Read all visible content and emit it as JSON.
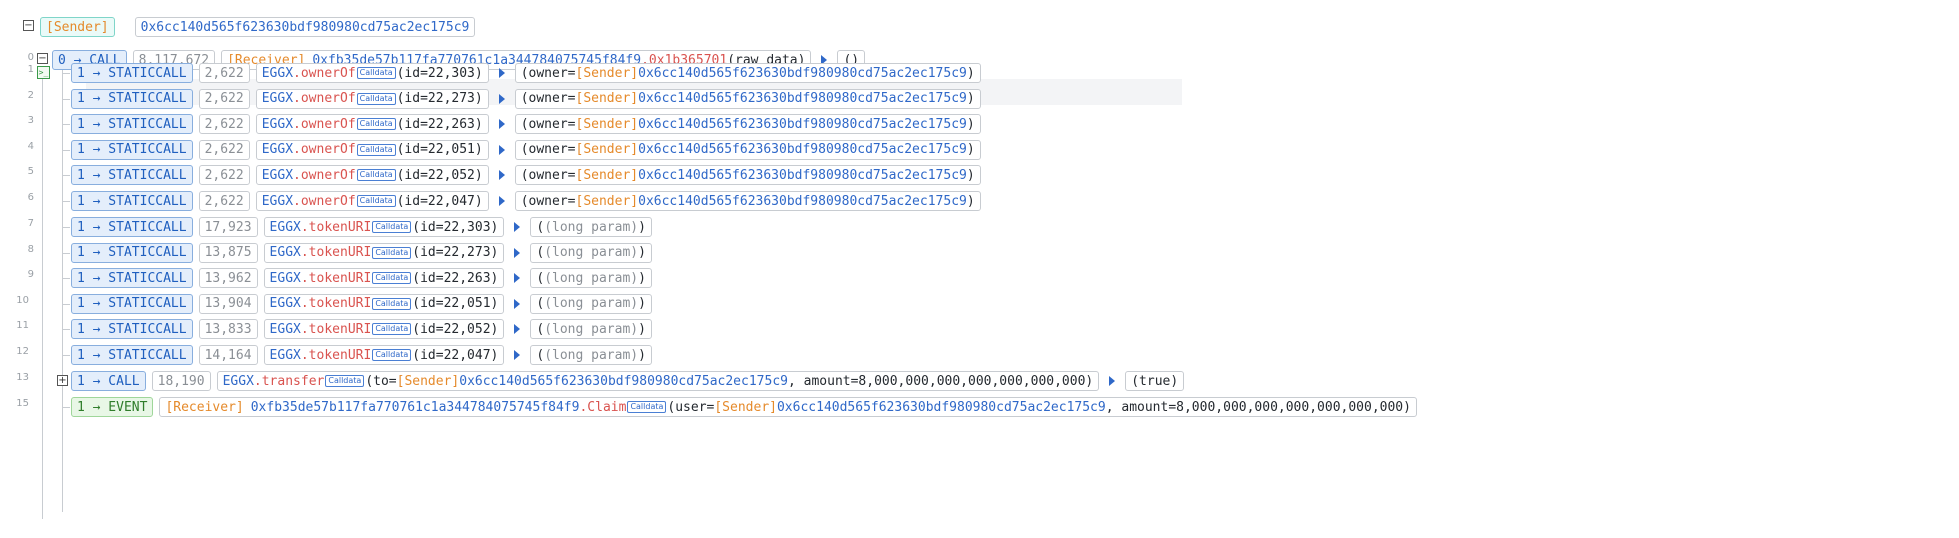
{
  "root": {
    "sender_label": "[Sender]",
    "sender_address": "0x6cc140d565f623630bdf980980cd75ac2ec175c9"
  },
  "main_call": {
    "line": "0",
    "call_label": "0 → CALL",
    "gas": "8,117,672",
    "receiver_label": "[Receiver]",
    "receiver_address": "0xfb35de57b117fa770761c1a344784075745f84f9",
    "selector": ".0x1b365701",
    "raw": "(raw data)",
    "result": "()"
  },
  "calldata_badge": "Calldata",
  "owner_calls": [
    {
      "line": "1",
      "call_label": "1 → STATICCALL",
      "gas": "2,622",
      "contract": "EGGX",
      "method": ".ownerOf",
      "args": "(id=22,303)",
      "ret_open": "(owner=",
      "ret_tag": "[Sender]",
      "ret_addr": "0x6cc140d565f623630bdf980980cd75ac2ec175c9",
      "ret_close": ")"
    },
    {
      "line": "2",
      "call_label": "1 → STATICCALL",
      "gas": "2,622",
      "contract": "EGGX",
      "method": ".ownerOf",
      "args": "(id=22,273)",
      "ret_open": "(owner=",
      "ret_tag": "[Sender]",
      "ret_addr": "0x6cc140d565f623630bdf980980cd75ac2ec175c9",
      "ret_close": ")"
    },
    {
      "line": "3",
      "call_label": "1 → STATICCALL",
      "gas": "2,622",
      "contract": "EGGX",
      "method": ".ownerOf",
      "args": "(id=22,263)",
      "ret_open": "(owner=",
      "ret_tag": "[Sender]",
      "ret_addr": "0x6cc140d565f623630bdf980980cd75ac2ec175c9",
      "ret_close": ")"
    },
    {
      "line": "4",
      "call_label": "1 → STATICCALL",
      "gas": "2,622",
      "contract": "EGGX",
      "method": ".ownerOf",
      "args": "(id=22,051)",
      "ret_open": "(owner=",
      "ret_tag": "[Sender]",
      "ret_addr": "0x6cc140d565f623630bdf980980cd75ac2ec175c9",
      "ret_close": ")"
    },
    {
      "line": "5",
      "call_label": "1 → STATICCALL",
      "gas": "2,622",
      "contract": "EGGX",
      "method": ".ownerOf",
      "args": "(id=22,052)",
      "ret_open": "(owner=",
      "ret_tag": "[Sender]",
      "ret_addr": "0x6cc140d565f623630bdf980980cd75ac2ec175c9",
      "ret_close": ")"
    },
    {
      "line": "6",
      "call_label": "1 → STATICCALL",
      "gas": "2,622",
      "contract": "EGGX",
      "method": ".ownerOf",
      "args": "(id=22,047)",
      "ret_open": "(owner=",
      "ret_tag": "[Sender]",
      "ret_addr": "0x6cc140d565f623630bdf980980cd75ac2ec175c9",
      "ret_close": ")"
    }
  ],
  "uri_calls": [
    {
      "line": "7",
      "call_label": "1 → STATICCALL",
      "gas": "17,923",
      "contract": "EGGX",
      "method": ".tokenURI",
      "args": "(id=22,303)",
      "ret_open": "(",
      "ret_inner": "(long param)",
      "ret_close": ")"
    },
    {
      "line": "8",
      "call_label": "1 → STATICCALL",
      "gas": "13,875",
      "contract": "EGGX",
      "method": ".tokenURI",
      "args": "(id=22,273)",
      "ret_open": "(",
      "ret_inner": "(long param)",
      "ret_close": ")"
    },
    {
      "line": "9",
      "call_label": "1 → STATICCALL",
      "gas": "13,962",
      "contract": "EGGX",
      "method": ".tokenURI",
      "args": "(id=22,263)",
      "ret_open": "(",
      "ret_inner": "(long param)",
      "ret_close": ")"
    },
    {
      "line": "10",
      "call_label": "1 → STATICCALL",
      "gas": "13,904",
      "contract": "EGGX",
      "method": ".tokenURI",
      "args": "(id=22,051)",
      "ret_open": "(",
      "ret_inner": "(long param)",
      "ret_close": ")"
    },
    {
      "line": "11",
      "call_label": "1 → STATICCALL",
      "gas": "13,833",
      "contract": "EGGX",
      "method": ".tokenURI",
      "args": "(id=22,052)",
      "ret_open": "(",
      "ret_inner": "(long param)",
      "ret_close": ")"
    },
    {
      "line": "12",
      "call_label": "1 → STATICCALL",
      "gas": "14,164",
      "contract": "EGGX",
      "method": ".tokenURI",
      "args": "(id=22,047)",
      "ret_open": "(",
      "ret_inner": "(long param)",
      "ret_close": ")"
    }
  ],
  "transfer_call": {
    "line": "13",
    "call_label": "1 → CALL",
    "gas": "18,190",
    "contract": "EGGX",
    "method": ".transfer",
    "args_open": "(to=",
    "args_tag": "[Sender]",
    "args_addr": "0x6cc140d565f623630bdf980980cd75ac2ec175c9",
    "args_rest": ", amount=8,000,000,000,000,000,000,000)",
    "result": "(true)"
  },
  "event": {
    "line": "15",
    "label": "1 → EVENT",
    "receiver_label": "[Receiver]",
    "receiver_address": "0xfb35de57b117fa770761c1a344784075745f84f9",
    "method": ".Claim",
    "args_open": "(user=",
    "args_tag": "[Sender]",
    "args_addr": "0x6cc140d565f623630bdf980980cd75ac2ec175c9",
    "args_rest": ", amount=8,000,000,000,000,000,000,000)"
  }
}
